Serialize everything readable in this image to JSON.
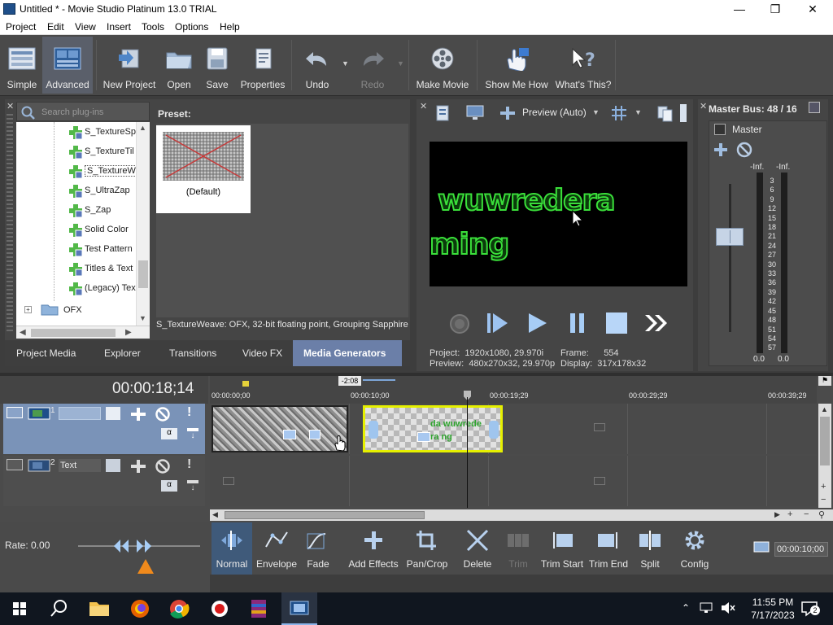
{
  "window": {
    "title": "Untitled * - Movie Studio Platinum 13.0 TRIAL"
  },
  "menu": [
    "Project",
    "Edit",
    "View",
    "Insert",
    "Tools",
    "Options",
    "Help"
  ],
  "toolbar": {
    "simple": "Simple",
    "advanced": "Advanced",
    "new_project": "New Project",
    "open": "Open",
    "save": "Save",
    "properties": "Properties",
    "undo": "Undo",
    "redo": "Redo",
    "make_movie": "Make Movie",
    "show_me_how": "Show Me How",
    "whats_this": "What's This?"
  },
  "plugins": {
    "search_placeholder": "Search plug-ins",
    "tree": [
      "S_TextureSp",
      "S_TextureTil",
      "S_TextureWe",
      "S_UltraZap",
      "S_Zap",
      "Solid Color",
      "Test Pattern",
      "Titles & Text",
      "(Legacy) Tex"
    ],
    "selected_index": 2,
    "folder": "OFX",
    "preset_label": "Preset:",
    "preset_default": "(Default)",
    "description": "S_TextureWeave: OFX, 32-bit floating point, Grouping  Sapphire",
    "tabs": [
      "Project Media",
      "Explorer",
      "Transitions",
      "Video FX",
      "Media Generators"
    ],
    "active_tab": "Media Generators"
  },
  "preview": {
    "mode": "Preview (Auto)",
    "text_line1": "wuwredera",
    "text_line2": "ming",
    "project_label": "Project:",
    "project_value": "1920x1080, 29.970i",
    "preview_label": "Preview:",
    "preview_value": "480x270x32, 29.970p",
    "frame_label": "Frame:",
    "frame_value": "554",
    "display_label": "Display:",
    "display_value": "317x178x32"
  },
  "master": {
    "title": "Master Bus: 48 / 16",
    "label": "Master",
    "inf_left": "-Inf.",
    "inf_right": "-Inf.",
    "scale": [
      "3",
      "6",
      "9",
      "12",
      "15",
      "18",
      "21",
      "24",
      "27",
      "30",
      "33",
      "36",
      "39",
      "42",
      "45",
      "48",
      "51",
      "54",
      "57"
    ],
    "bottom_left": "0.0",
    "bottom_right": "0.0"
  },
  "timeline": {
    "timecode": "00:00:18;14",
    "marker": "-2:08",
    "ruler": [
      "00:00:00;00",
      "00:00:10;00",
      "00:00:19;29",
      "00:00:29;29",
      "00:00:39;29"
    ],
    "track1_num": "1",
    "track1_name": "",
    "track2_num": "2",
    "track2_name": "Text",
    "clip2_text1": "da wuwrede",
    "clip2_text2": "ra ng",
    "rate": "Rate: 0.00",
    "end_time": "00:00:10;00"
  },
  "edit_tools": [
    "Normal",
    "Envelope",
    "Fade",
    "Add Effects",
    "Pan/Crop",
    "Delete",
    "Trim",
    "Trim Start",
    "Trim End",
    "Split",
    "Config"
  ],
  "clock": {
    "time": "11:55 PM",
    "date": "7/17/2023"
  },
  "notification_count": "2",
  "colors": {
    "accent": "#4a8ad4",
    "selected_tab": "#6b7fa8",
    "clip_select": "#e6f000"
  }
}
